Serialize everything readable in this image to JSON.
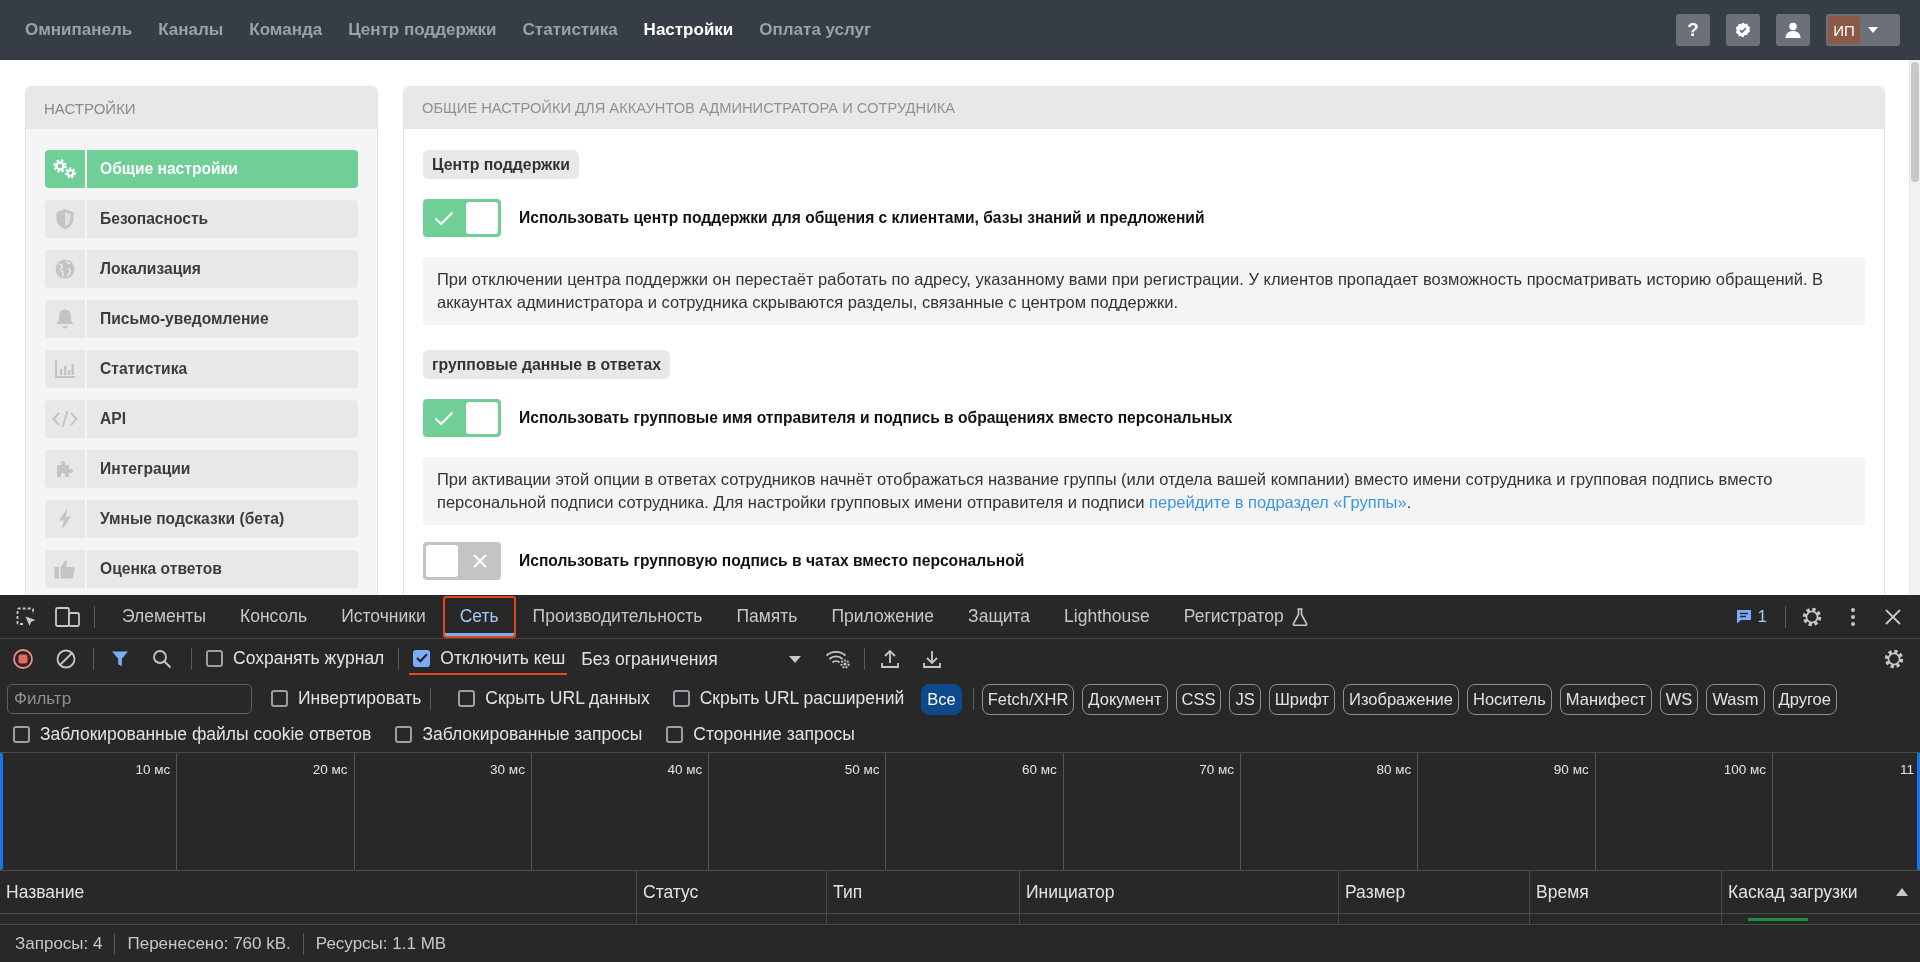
{
  "top_nav": {
    "items": [
      {
        "label": "Омнипанель",
        "selected": false
      },
      {
        "label": "Каналы",
        "selected": false
      },
      {
        "label": "Команда",
        "selected": false
      },
      {
        "label": "Центр поддержки",
        "selected": false
      },
      {
        "label": "Статистика",
        "selected": false
      },
      {
        "label": "Настройки",
        "selected": true
      },
      {
        "label": "Оплата услуг",
        "selected": false
      }
    ],
    "help_label": "?",
    "avatar_initials": "ИП"
  },
  "sidebar": {
    "title": "НАСТРОЙКИ",
    "items": [
      {
        "label": "Общие настройки",
        "selected": true
      },
      {
        "label": "Безопасность",
        "selected": false
      },
      {
        "label": "Локализация",
        "selected": false
      },
      {
        "label": "Письмо-уведомление",
        "selected": false
      },
      {
        "label": "Статистика",
        "selected": false
      },
      {
        "label": "API",
        "selected": false
      },
      {
        "label": "Интеграции",
        "selected": false
      },
      {
        "label": "Умные подсказки (бета)",
        "selected": false
      },
      {
        "label": "Оценка ответов",
        "selected": false
      }
    ]
  },
  "settings_panel": {
    "title": "ОБЩИЕ НАСТРОЙКИ ДЛЯ АККАУНТОВ АДМИНИСТРАТОРА И СОТРУДНИКА",
    "blocks": [
      {
        "kind": "heading",
        "text": "Центр поддержки"
      },
      {
        "kind": "toggle",
        "label": "Использовать центр поддержки для общения с клиентами, базы знаний и предложений",
        "on": true
      },
      {
        "kind": "note",
        "text": "При отключении центра поддержки он перестаёт работать по адресу, указанному вами при регистрации. У клиентов пропадает возможность просматривать историю обращений. В аккаунтах администратора и сотрудника скрываются разделы, связанные с центром поддержки."
      },
      {
        "kind": "heading",
        "text": "групповые данные в ответах"
      },
      {
        "kind": "toggle",
        "label": "Использовать групповые имя отправителя и подпись в обращениях вместо персональных",
        "on": true
      },
      {
        "kind": "note",
        "text": "При активации этой опции в ответах сотрудников начнёт отображаться название группы (или отдела вашей компании) вместо имени сотрудника и групповая подпись вместо персональной подписи сотрудника. Для настройки групповых имени отправителя и подписи ",
        "link": "перейдите в подраздел «Группы»",
        "text_after": "."
      },
      {
        "kind": "toggle",
        "label": "Использовать групповую подпись в чатах вместо персональной",
        "on": false
      }
    ]
  },
  "devtools": {
    "tabs": [
      {
        "label": "Элементы",
        "selected": false,
        "annotated": false,
        "experimental": false
      },
      {
        "label": "Консоль",
        "selected": false,
        "annotated": false,
        "experimental": false
      },
      {
        "label": "Источники",
        "selected": false,
        "annotated": false,
        "experimental": false
      },
      {
        "label": "Сеть",
        "selected": true,
        "annotated": true,
        "experimental": false
      },
      {
        "label": "Производительность",
        "selected": false,
        "annotated": false,
        "experimental": false
      },
      {
        "label": "Память",
        "selected": false,
        "annotated": false,
        "experimental": false
      },
      {
        "label": "Приложение",
        "selected": false,
        "annotated": false,
        "experimental": false
      },
      {
        "label": "Защита",
        "selected": false,
        "annotated": false,
        "experimental": false
      },
      {
        "label": "Lighthouse",
        "selected": false,
        "annotated": false,
        "experimental": false
      },
      {
        "label": "Регистратор",
        "selected": false,
        "annotated": false,
        "experimental": true
      }
    ],
    "issues_count": "1",
    "toolbar_checkboxes": [
      {
        "label": "Сохранять журнал",
        "checked": false,
        "annotated": false
      },
      {
        "label": "Отключить кеш",
        "checked": true,
        "annotated": true
      }
    ],
    "throttling": "Без ограничения",
    "filter": {
      "placeholder": "Фильтр"
    },
    "filter_checkboxes": [
      {
        "label": "Инвертировать",
        "checked": false
      },
      {
        "label": "Скрыть URL данных",
        "checked": false
      },
      {
        "label": "Скрыть URL расширений",
        "checked": false
      }
    ],
    "type_filters": [
      {
        "label": "Все",
        "selected": true
      },
      {
        "label": "Fetch/XHR",
        "selected": false
      },
      {
        "label": "Документ",
        "selected": false
      },
      {
        "label": "CSS",
        "selected": false
      },
      {
        "label": "JS",
        "selected": false
      },
      {
        "label": "Шрифт",
        "selected": false
      },
      {
        "label": "Изображение",
        "selected": false
      },
      {
        "label": "Носитель",
        "selected": false
      },
      {
        "label": "Манифест",
        "selected": false
      },
      {
        "label": "WS",
        "selected": false
      },
      {
        "label": "Wasm",
        "selected": false
      },
      {
        "label": "Другое",
        "selected": false
      }
    ],
    "extra_checkboxes": [
      {
        "label": "Заблокированные файлы cookie ответов",
        "checked": false
      },
      {
        "label": "Заблокированные запросы",
        "checked": false
      },
      {
        "label": "Сторонние запросы",
        "checked": false
      }
    ],
    "timeline_ticks": [
      "10 мс",
      "20 мс",
      "30 мс",
      "40 мс",
      "50 мс",
      "60 мс",
      "70 мс",
      "80 мс",
      "90 мс",
      "100 мс",
      "11"
    ],
    "table": {
      "columns": [
        {
          "label": "Название",
          "sorted": false
        },
        {
          "label": "Статус",
          "sorted": false
        },
        {
          "label": "Тип",
          "sorted": false
        },
        {
          "label": "Инициатор",
          "sorted": false
        },
        {
          "label": "Размер",
          "sorted": false
        },
        {
          "label": "Время",
          "sorted": false
        },
        {
          "label": "Каскад загрузки",
          "sorted": true
        }
      ]
    },
    "status_bar": [
      "Запросы: 4",
      "Перенесено: 760 kB.",
      "Ресурсы: 1.1 MB"
    ]
  }
}
